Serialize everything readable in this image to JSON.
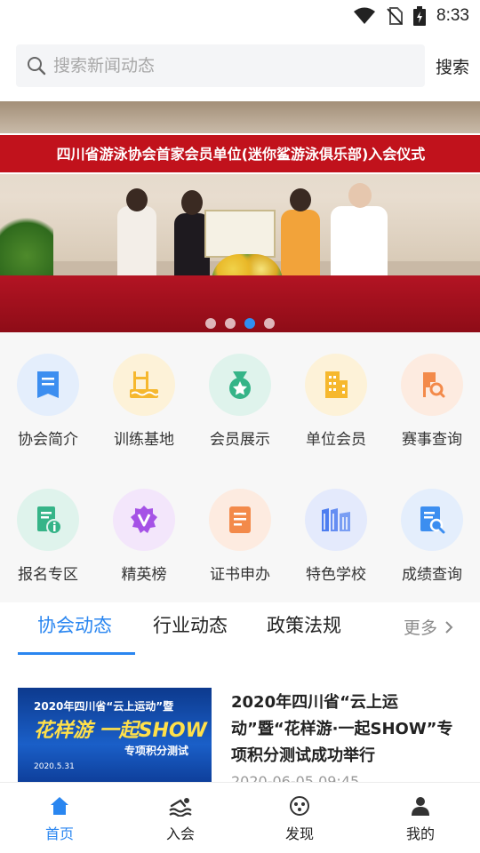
{
  "status_bar": {
    "time": "8:33"
  },
  "search": {
    "placeholder": "搜索新闻动态",
    "button_label": "搜索"
  },
  "banner": {
    "headline": "四川省游泳协会首家会员单位(迷你鲨游泳俱乐部)入会仪式",
    "slide_count": 4,
    "active_slide": 3
  },
  "grid": {
    "items": [
      {
        "label": "协会简介",
        "icon": "book-icon",
        "bg": "#e4eefc",
        "color": "#3c8ef0"
      },
      {
        "label": "训练基地",
        "icon": "pool-icon",
        "bg": "#fdf2d8",
        "color": "#f6b82e"
      },
      {
        "label": "会员展示",
        "icon": "medal-icon",
        "bg": "#dff3ec",
        "color": "#36b488"
      },
      {
        "label": "单位会员",
        "icon": "building-icon",
        "bg": "#fdf2d8",
        "color": "#f6b82e"
      },
      {
        "label": "赛事查询",
        "icon": "event-search-icon",
        "bg": "#fdebe0",
        "color": "#f38a4a"
      },
      {
        "label": "报名专区",
        "icon": "signup-icon",
        "bg": "#dff3ec",
        "color": "#36b488"
      },
      {
        "label": "精英榜",
        "icon": "elite-icon",
        "bg": "#f3e6fb",
        "color": "#a552e6"
      },
      {
        "label": "证书申办",
        "icon": "certificate-icon",
        "bg": "#fdebe0",
        "color": "#f38a4a"
      },
      {
        "label": "特色学校",
        "icon": "school-icon",
        "bg": "#e4eafc",
        "color": "#4d7df0"
      },
      {
        "label": "成绩查询",
        "icon": "score-search-icon",
        "bg": "#e4eefc",
        "color": "#3c8ef0"
      }
    ]
  },
  "tabs": {
    "items": [
      "协会动态",
      "行业动态",
      "政策法规"
    ],
    "active_index": 0,
    "more_label": "更多"
  },
  "news": [
    {
      "title": "2020年四川省“云上运动”暨“花样游·一起SHOW”专项积分测试成功举行",
      "date": "2020-06-05 09:45",
      "thumb": {
        "line1": "2020年四川省“云上运动”暨",
        "line2": "花样游 一起SHOW",
        "line3": "专项积分测试",
        "line4": "2020.5.31"
      }
    }
  ],
  "bottom_nav": {
    "items": [
      {
        "label": "首页",
        "icon": "home-icon"
      },
      {
        "label": "入会",
        "icon": "swim-icon"
      },
      {
        "label": "发现",
        "icon": "discover-icon"
      },
      {
        "label": "我的",
        "icon": "profile-icon"
      }
    ],
    "active_index": 0
  },
  "colors": {
    "accent": "#2a86f0",
    "banner_red": "#c1121c"
  }
}
